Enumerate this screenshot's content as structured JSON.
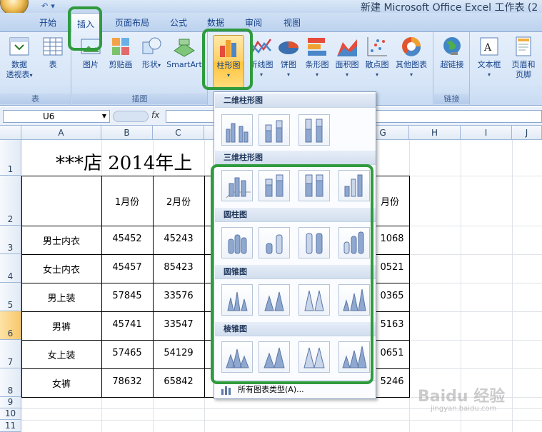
{
  "window": {
    "title": "新建 Microsoft Office Excel 工作表 (2"
  },
  "tabs": [
    "开始",
    "插入",
    "页面布局",
    "公式",
    "数据",
    "审阅",
    "视图"
  ],
  "ribbon": {
    "groups": [
      {
        "label": "表",
        "buttons": [
          "数据\n透视表",
          "表"
        ]
      },
      {
        "label": "插图",
        "buttons": [
          "图片",
          "剪贴画",
          "形状",
          "SmartArt"
        ]
      },
      {
        "label": "",
        "buttons": [
          "柱形图",
          "折线图",
          "饼图",
          "条形图",
          "面积图",
          "散点图",
          "其他图表"
        ]
      },
      {
        "label": "链接",
        "buttons": [
          "超链接"
        ]
      },
      {
        "label": "",
        "buttons": [
          "文本框",
          "页眉和\n页脚"
        ]
      }
    ],
    "pivot_line1": "数据",
    "pivot_line2": "透视表",
    "header_line1": "页眉和",
    "header_line2": "页脚"
  },
  "formula_bar": {
    "name_box": "U6",
    "fx": "fx"
  },
  "columns": [
    "A",
    "B",
    "C",
    "G",
    "H",
    "I",
    "J"
  ],
  "rows": [
    "1",
    "2",
    "3",
    "4",
    "5",
    "6",
    "7",
    "8",
    "9",
    "10",
    "11"
  ],
  "sheet": {
    "title": "***店  2014年上",
    "month_headers": [
      "1月份",
      "2月份",
      "月份"
    ],
    "items": [
      {
        "name": "男士内衣",
        "b": "45452",
        "c": "45243",
        "g": "1068"
      },
      {
        "name": "女士内衣",
        "b": "45457",
        "c": "85423",
        "g": "0521"
      },
      {
        "name": "男上装",
        "b": "57845",
        "c": "33576",
        "g": "0365"
      },
      {
        "name": "男裤",
        "b": "45741",
        "c": "33547",
        "g": "5163"
      },
      {
        "name": "女上装",
        "b": "57465",
        "c": "54129",
        "g": "0651"
      },
      {
        "name": "女裤",
        "b": "78632",
        "c": "65842",
        "g": "5246"
      }
    ]
  },
  "dropdown": {
    "sections": [
      "二维柱形图",
      "三维柱形图",
      "圆柱图",
      "圆锥图",
      "棱锥图"
    ],
    "footer": "所有图表类型(A)..."
  },
  "watermark": {
    "main": "Baidu 经验",
    "sub": "jingyan.baidu.com"
  },
  "colors": {
    "highlight": "#2f9b3e",
    "selected_row": "#f8c86a"
  }
}
